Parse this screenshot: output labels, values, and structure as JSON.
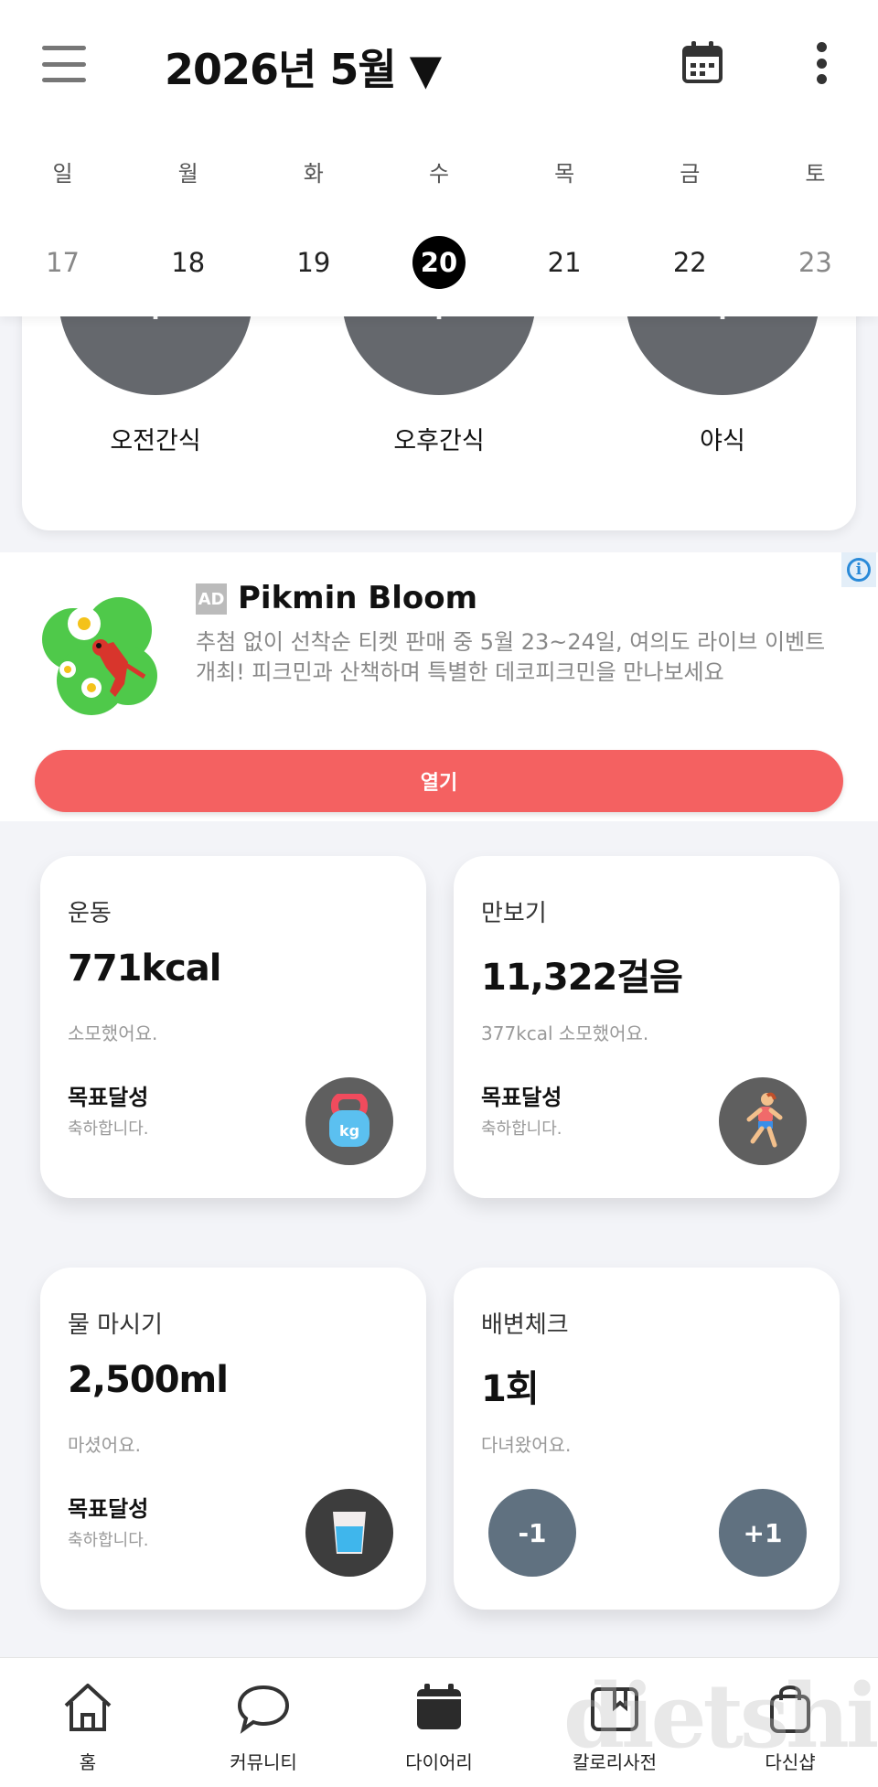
{
  "header": {
    "month_label": "2026년 5월 ▼",
    "week": [
      {
        "name": "일",
        "date": "17",
        "weekend": true
      },
      {
        "name": "월",
        "date": "18"
      },
      {
        "name": "화",
        "date": "19"
      },
      {
        "name": "수",
        "date": "20",
        "selected": true
      },
      {
        "name": "목",
        "date": "21"
      },
      {
        "name": "금",
        "date": "22"
      },
      {
        "name": "토",
        "date": "23",
        "weekend": true
      }
    ]
  },
  "snacks": [
    {
      "plus": "+",
      "label": "오전간식"
    },
    {
      "plus": "+",
      "label": "오후간식"
    },
    {
      "plus": "+",
      "label": "야식"
    }
  ],
  "ad": {
    "badge": "AD",
    "title": "Pikmin Bloom",
    "description": "추첨 없이 선착순 티켓 판매 중 5월 23~24일, 여의도 라이브 이벤트 개최! 피크민과 산책하며 특별한 데코피크민을 만나보세요",
    "button": "열기",
    "info_icon": "info-icon"
  },
  "cards": {
    "exercise": {
      "title": "운동",
      "value": "771kcal",
      "sub": "소모했어요.",
      "goal": "목표달성",
      "goal_sub": "축하합니다.",
      "icon": "kettlebell-icon"
    },
    "pedometer": {
      "title": "만보기",
      "value": "11,322걸음",
      "sub": "377kcal 소모했어요.",
      "goal": "목표달성",
      "goal_sub": "축하합니다.",
      "icon": "runner-icon"
    },
    "water": {
      "title": "물 마시기",
      "value": "2,500ml",
      "sub": "마셨어요.",
      "goal": "목표달성",
      "goal_sub": "축하합니다.",
      "icon": "water-glass-icon"
    },
    "bowel": {
      "title": "배변체크",
      "value": "1회",
      "sub": "다녀왔어요.",
      "minus": "-1",
      "plus": "+1"
    }
  },
  "bottom_nav": [
    {
      "label": "홈",
      "icon": "home-icon"
    },
    {
      "label": "커뮤니티",
      "icon": "chat-icon"
    },
    {
      "label": "다이어리",
      "icon": "diary-icon"
    },
    {
      "label": "칼로리사전",
      "icon": "calorie-dictionary-icon"
    },
    {
      "label": "다신샵",
      "icon": "shopping-bag-icon"
    }
  ],
  "watermark": "dietshin",
  "colors": {
    "accent_red": "#f46161",
    "snack_gray": "#65686d",
    "counter_blue": "#607180",
    "selected_date": "#000000"
  }
}
